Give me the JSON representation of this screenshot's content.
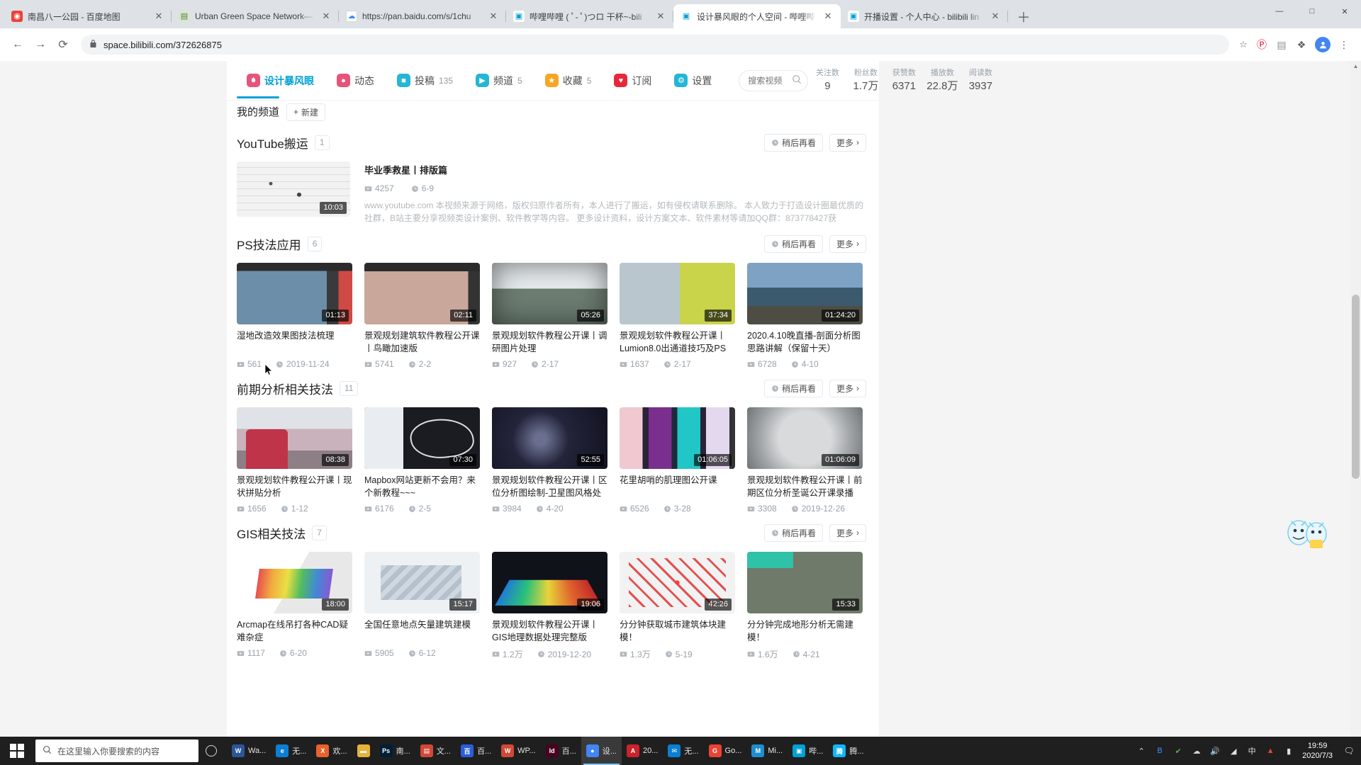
{
  "browser": {
    "tabs": [
      {
        "title": "南昌八一公园 - 百度地图",
        "fav": "baidu-map-icon",
        "favclass": "fav-baidu",
        "favglyph": "◉",
        "active": false
      },
      {
        "title": "Urban Green Space Network—",
        "fav": "document-icon",
        "favclass": "fav-doc",
        "favglyph": "▤",
        "active": false
      },
      {
        "title": "https://pan.baidu.com/s/1chu",
        "fav": "baidu-pan-icon",
        "favclass": "fav-pan",
        "favglyph": "☁",
        "active": false
      },
      {
        "title": "哔哩哔哩 ( ﾟ- ﾟ)つロ 干杯~-bili",
        "fav": "bilibili-icon",
        "favclass": "fav-bili",
        "favglyph": "▣",
        "active": false
      },
      {
        "title": "设计暴风眼的个人空间 - 哔哩哔",
        "fav": "bilibili-icon",
        "favclass": "fav-bili",
        "favglyph": "▣",
        "active": true
      },
      {
        "title": "开播设置 - 个人中心 - bilibili lin",
        "fav": "bilibili-icon",
        "favclass": "fav-bili",
        "favglyph": "▣",
        "active": false
      }
    ],
    "close_glyph": "✕",
    "newtab_glyph": "＋",
    "window_controls": {
      "minimize": "—",
      "maximize": "□",
      "close": "✕"
    },
    "nav": {
      "back": "←",
      "forward": "→",
      "reload": "⟳"
    },
    "url": "space.bilibili.com/372626875",
    "lock_glyph": "🔒",
    "omnibox_icons": [
      "star-icon"
    ],
    "star_glyph": "☆",
    "extensions": [
      {
        "name": "pinterest-extension-icon",
        "glyph": "Ⓟ",
        "color": "#e60023"
      },
      {
        "name": "note-extension-icon",
        "glyph": "▤",
        "color": "#8a8f94"
      },
      {
        "name": "puzzle-extension-icon",
        "glyph": "❖",
        "color": "#5f6368"
      }
    ],
    "profile_glyph": "●",
    "menu_glyph": "⋮"
  },
  "profile_nav": {
    "brand": {
      "label": "设计暴风眼",
      "icon": "flame-icon",
      "color": "#e8537a"
    },
    "items": [
      {
        "label": "动态",
        "count": "",
        "icon": "dynamic-icon",
        "color": "#e8537a",
        "glyph": "●"
      },
      {
        "label": "投稿",
        "count": "135",
        "icon": "upload-icon",
        "color": "#23b7d4",
        "glyph": "■"
      },
      {
        "label": "频道",
        "count": "5",
        "icon": "channel-icon",
        "color": "#23b7d4",
        "glyph": "▶"
      },
      {
        "label": "收藏",
        "count": "5",
        "icon": "star-icon",
        "color": "#f5a623",
        "glyph": "★"
      },
      {
        "label": "订阅",
        "count": "",
        "icon": "heart-icon",
        "color": "#e8273a",
        "glyph": "♥"
      },
      {
        "label": "设置",
        "count": "",
        "icon": "gear-icon",
        "color": "#23b7d4",
        "glyph": "⚙"
      }
    ],
    "search": {
      "placeholder": "搜索视频",
      "value": "",
      "icon": "search-icon"
    },
    "stats": [
      {
        "label": "关注数",
        "value": "9"
      },
      {
        "label": "粉丝数",
        "value": "1.7万"
      },
      {
        "label": "获赞数",
        "value": "6371"
      },
      {
        "label": "播放数",
        "value": "22.8万"
      },
      {
        "label": "阅读数",
        "value": "3937"
      }
    ]
  },
  "channel_tabs": {
    "my_channel": "我的频道",
    "new_button": "新建",
    "new_icon": "plus-icon"
  },
  "common": {
    "watch_later": "稍后再看",
    "more": "更多",
    "watch_later_icon": "clock-icon",
    "more_icon": "chevron-right-icon",
    "play_icon": "play-count-icon",
    "date_icon": "clock-icon"
  },
  "sections": [
    {
      "title": "YouTube搬运",
      "count": "1",
      "layout": "feature",
      "feature": {
        "title": "毕业季救星丨排版篇",
        "plays": "4257",
        "date": "6-9",
        "duration": "10:03",
        "thumb": "t-yt",
        "description": "www.youtube.com 本视频来源于网络，版权归原作者所有，本人进行了搬运，如有侵权请联系删除。 本人致力于打造设计圈最优质的社群，B站主要分享视频类设计案例、软件教学等内容。 更多设计资料，设计方案文本、软件素材等请加QQ群：873778427获"
      },
      "videos": []
    },
    {
      "title": "PS技法应用",
      "count": "6",
      "layout": "grid",
      "videos": [
        {
          "title": "湿地改造效果图技法梳理",
          "plays": "561",
          "date": "2019-11-24",
          "duration": "01:13",
          "thumb": "t-ps1"
        },
        {
          "title": "景观规划建筑软件教程公开课丨鸟瞰加速版",
          "plays": "5741",
          "date": "2-2",
          "duration": "02:11",
          "thumb": "t-ps2"
        },
        {
          "title": "景观规划软件教程公开课丨调研图片处理",
          "plays": "927",
          "date": "2-17",
          "duration": "05:26",
          "thumb": "t-ps3"
        },
        {
          "title": "景观规划软件教程公开课丨Lumion8.0出通道技巧及PS",
          "plays": "1637",
          "date": "2-17",
          "duration": "37:34",
          "thumb": "t-ps4"
        },
        {
          "title": "2020.4.10晚直播-剖面分析图思路讲解（保留十天）",
          "plays": "6728",
          "date": "4-10",
          "duration": "01:24:20",
          "thumb": "t-ps5"
        }
      ]
    },
    {
      "title": "前期分析相关技法",
      "count": "11",
      "layout": "grid",
      "videos": [
        {
          "title": "景观规划软件教程公开课丨现状拼贴分析",
          "plays": "1656",
          "date": "1-12",
          "duration": "08:38",
          "thumb": "t-q1"
        },
        {
          "title": "Mapbox网站更新不会用？来个新教程~~~",
          "plays": "6176",
          "date": "2-5",
          "duration": "07:30",
          "thumb": "t-q2"
        },
        {
          "title": "景观规划软件教程公开课丨区位分析图绘制-卫星图风格处",
          "plays": "3984",
          "date": "4-20",
          "duration": "52:55",
          "thumb": "t-q3"
        },
        {
          "title": "花里胡哨的肌理图公开课",
          "plays": "6526",
          "date": "3-28",
          "duration": "01:06:05",
          "thumb": "t-q4"
        },
        {
          "title": "景观规划软件教程公开课丨前期区位分析圣诞公开课录播",
          "plays": "3308",
          "date": "2019-12-26",
          "duration": "01:06:09",
          "thumb": "t-q5"
        }
      ]
    },
    {
      "title": "GIS相关技法",
      "count": "7",
      "layout": "grid",
      "videos": [
        {
          "title": "Arcmap在线吊打各种CAD疑难杂症",
          "plays": "1117",
          "date": "6-20",
          "duration": "18:00",
          "thumb": "t-g1"
        },
        {
          "title": "全国任意地点矢量建筑建模",
          "plays": "5905",
          "date": "6-12",
          "duration": "15:17",
          "thumb": "t-g2"
        },
        {
          "title": "景观规划软件教程公开课丨GIS地理数据处理完整版",
          "plays": "1.2万",
          "date": "2019-12-20",
          "duration": "19:06",
          "thumb": "t-g3"
        },
        {
          "title": "分分钟获取城市建筑体块建模！",
          "plays": "1.3万",
          "date": "5-19",
          "duration": "42:26",
          "thumb": "t-g4"
        },
        {
          "title": "分分钟完成地形分析无需建模！",
          "plays": "1.6万",
          "date": "4-21",
          "duration": "15:33",
          "thumb": "t-g5"
        }
      ]
    }
  ],
  "taskbar": {
    "search_placeholder": "在这里输入你要搜索的内容",
    "search_icon": "search-icon",
    "cortana_icon": "cortana-circle-icon",
    "apps": [
      {
        "label": "Wa...",
        "icon": "word-icon",
        "glyph": "W",
        "color": "#2b579a",
        "active": false
      },
      {
        "label": "无...",
        "icon": "edge-icon",
        "glyph": "e",
        "color": "#0b7fd4",
        "active": false
      },
      {
        "label": "欢...",
        "icon": "xmind-icon",
        "glyph": "X",
        "color": "#e8622c",
        "active": false
      },
      {
        "label": "",
        "icon": "folder-icon",
        "glyph": "▬",
        "color": "#e8b339",
        "active": false
      },
      {
        "label": "南...",
        "icon": "photoshop-icon",
        "glyph": "Ps",
        "color": "#001e36",
        "active": false
      },
      {
        "label": "文...",
        "icon": "wps-doc-icon",
        "glyph": "▤",
        "color": "#d14836",
        "active": false
      },
      {
        "label": "百...",
        "icon": "baidu-icon",
        "glyph": "百",
        "color": "#2b5fd9",
        "active": false
      },
      {
        "label": "WP...",
        "icon": "wps-icon",
        "glyph": "W",
        "color": "#d14836",
        "active": false
      },
      {
        "label": "百...",
        "icon": "indesign-icon",
        "glyph": "Id",
        "color": "#49021f",
        "active": false
      },
      {
        "label": "设...",
        "icon": "chrome-icon",
        "glyph": "●",
        "color": "#4285f4",
        "active": true
      },
      {
        "label": "20...",
        "icon": "acrobat-icon",
        "glyph": "A",
        "color": "#cc2229",
        "active": false
      },
      {
        "label": "无...",
        "icon": "mail-icon",
        "glyph": "✉",
        "color": "#0b7fd4",
        "active": false
      },
      {
        "label": "Go...",
        "icon": "google-icon",
        "glyph": "G",
        "color": "#ea4335",
        "active": false
      },
      {
        "label": "Mi...",
        "icon": "mindmaster-icon",
        "glyph": "M",
        "color": "#1f8ecd",
        "active": false
      },
      {
        "label": "哔...",
        "icon": "bilibili-live-icon",
        "glyph": "▣",
        "color": "#00a1d6",
        "active": false
      },
      {
        "label": "腾...",
        "icon": "tencent-icon",
        "glyph": "腾",
        "color": "#12b7f5",
        "active": false
      }
    ],
    "tray": [
      {
        "name": "show-hidden-icons",
        "glyph": "⌃"
      },
      {
        "name": "bluetooth-icon",
        "glyph": "B",
        "color": "#3b8cff"
      },
      {
        "name": "safety-icon",
        "glyph": "✔",
        "color": "#4caf50"
      },
      {
        "name": "onedrive-icon",
        "glyph": "☁",
        "color": "#d0d0d0"
      },
      {
        "name": "volume-icon",
        "glyph": "🔊"
      },
      {
        "name": "network-icon",
        "glyph": "◢"
      },
      {
        "name": "input-method-icon",
        "glyph": "中"
      },
      {
        "name": "flame-tray-icon",
        "glyph": "▲",
        "color": "#e8442c"
      },
      {
        "name": "power-icon",
        "glyph": "▮"
      }
    ],
    "clock": {
      "time": "19:59",
      "date": "2020/7/3"
    },
    "notification_glyph": "🗨"
  }
}
